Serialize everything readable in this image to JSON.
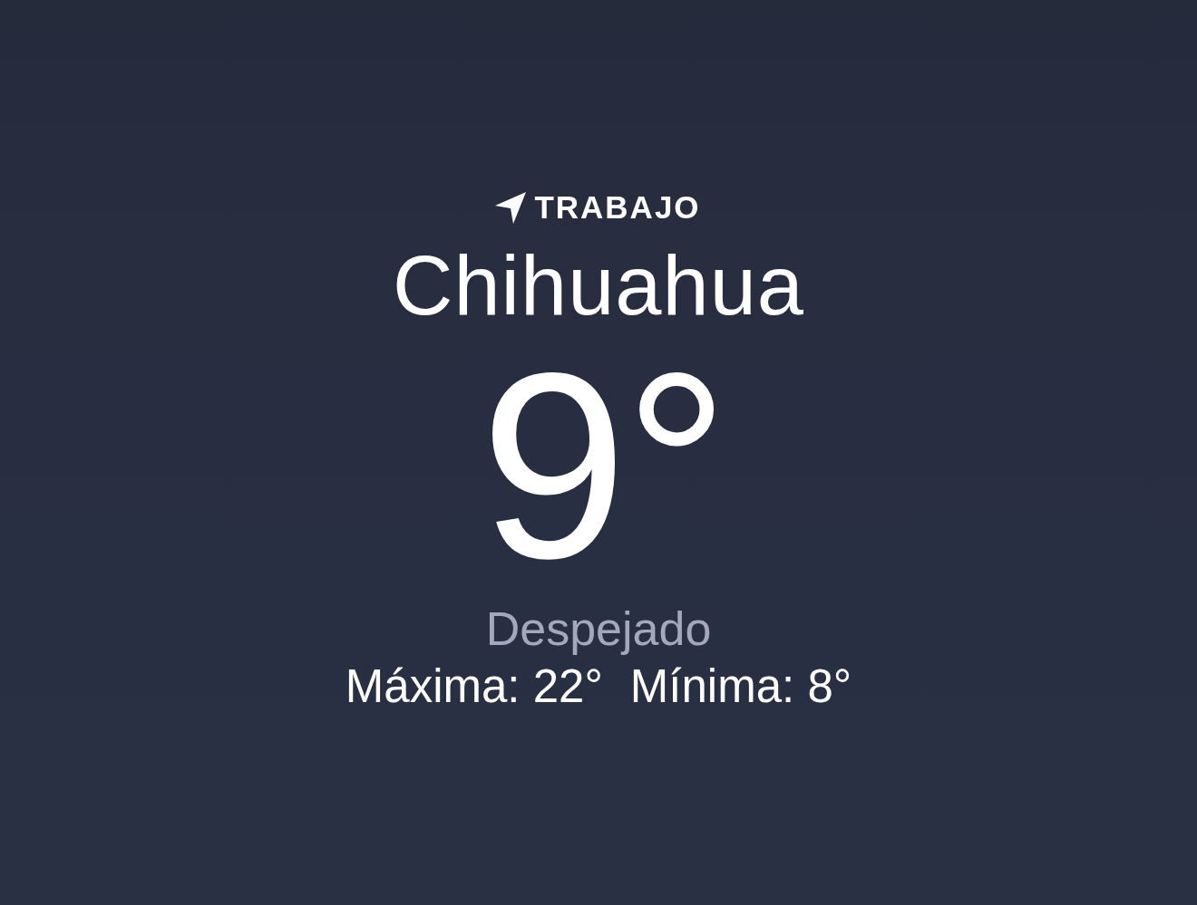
{
  "location_label": "TRABAJO",
  "city": "Chihuahua",
  "temperature": "9°",
  "condition": "Despejado",
  "high": "Máxima: 22°",
  "low": "Mínima: 8°"
}
